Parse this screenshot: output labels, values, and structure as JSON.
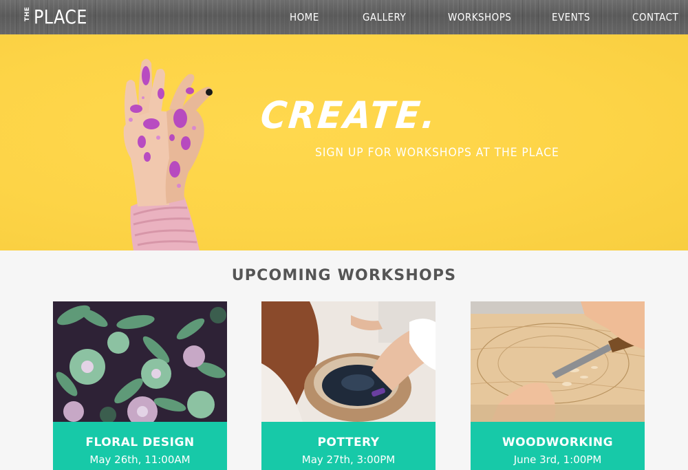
{
  "site": {
    "logo_small": "THE",
    "logo_main": "PLACE"
  },
  "nav": {
    "items": [
      {
        "label": "HOME"
      },
      {
        "label": "GALLERY"
      },
      {
        "label": "WORKSHOPS"
      },
      {
        "label": "EVENTS"
      },
      {
        "label": "CONTACT"
      }
    ]
  },
  "hero": {
    "title": "CREATE.",
    "subtitle": "SIGN UP FOR WORKSHOPS AT THE PLACE"
  },
  "workshops": {
    "heading": "UPCOMING WORKSHOPS",
    "cards": [
      {
        "name": "FLORAL DESIGN",
        "date": "May 26th, 11:00AM",
        "image": "succulents-photo"
      },
      {
        "name": "POTTERY",
        "date": "May 27th, 3:00PM",
        "image": "pottery-wheel-photo"
      },
      {
        "name": "WOODWORKING",
        "date": "June 3rd, 1:00PM",
        "image": "wood-carving-photo"
      }
    ]
  },
  "colors": {
    "hero_yellow": "#fdd447",
    "card_teal": "#17c9a8",
    "nav_wood": "#5f5f5f",
    "heading_gray": "#555555"
  }
}
